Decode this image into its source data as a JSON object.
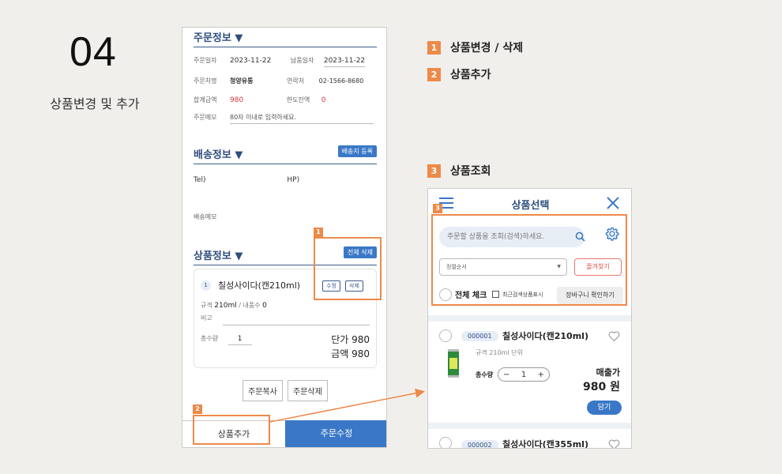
{
  "slide": {
    "number": "04",
    "title": "상품변경 및 추가"
  },
  "order_info": {
    "heading": "주문정보 ▼",
    "order_date_label": "주문일자",
    "order_date": "2023-11-22",
    "delivery_date_label": "납품일자",
    "delivery_date": "2023-11-22",
    "customer_label": "주문처명",
    "customer": "청양유통",
    "contact_label": "연락처",
    "contact": "02-1566-8680",
    "total_label": "합계금액",
    "total": "980",
    "limit_label": "한도잔액",
    "limit": "0",
    "memo_label": "주문메모",
    "memo_placeholder": "80자 이내로 입력하세요."
  },
  "shipping_info": {
    "heading": "배송정보 ▼",
    "register_btn": "배송지 등록",
    "tel_label": "Tel)",
    "hp_label": "HP)",
    "memo_label": "배송메모"
  },
  "product_info": {
    "heading": "상품정보 ▼",
    "delete_all_btn": "전체 삭제",
    "item": {
      "index": "1",
      "name": "칠성사이다(캔210ml)",
      "edit_btn": "수정",
      "delete_btn": "삭제",
      "spec_label": "규격",
      "spec": "210ml",
      "inner_label": "/ 내품수",
      "inner": "0",
      "note_label": "비고",
      "qty_label": "총수량",
      "qty": "1",
      "unit_price": "단가 980",
      "amount": "금액 980"
    },
    "copy_btn": "주문복사",
    "delete_order_btn": "주문삭제"
  },
  "bottom_bar": {
    "add_product": "상품추가",
    "edit_order": "주문수정"
  },
  "annotations": {
    "tag1": "1",
    "tag2": "2",
    "tag3": "3"
  },
  "legend": [
    {
      "num": "1",
      "label": "상품변경 / 삭제"
    },
    {
      "num": "2",
      "label": "상품추가"
    },
    {
      "num": "3",
      "label": "상품조회"
    }
  ],
  "product_select": {
    "title": "상품선택",
    "search_placeholder": "주문할 상품을 조회(검색)하세요.",
    "sort_value": "정렬순서",
    "favorites_btn": "즐겨찾기",
    "check_all": "전체 체크",
    "recent_label": "최근검색상품표시",
    "cart_btn": "장바구니 확인하기",
    "items": [
      {
        "code": "000001",
        "name": "칠성사이다(캔210ml)",
        "spec": "규격 210ml   단위",
        "qty_label": "총수량",
        "qty": "1",
        "price_label": "매출가",
        "price": "980 원",
        "add_btn": "담기"
      },
      {
        "code": "000002",
        "name": "칠성사이다(캔355ml)"
      }
    ]
  },
  "colors": {
    "accent": "#3a78c7",
    "navy": "#2e4e7e",
    "orange": "#ec8a49",
    "red": "#e03838"
  }
}
